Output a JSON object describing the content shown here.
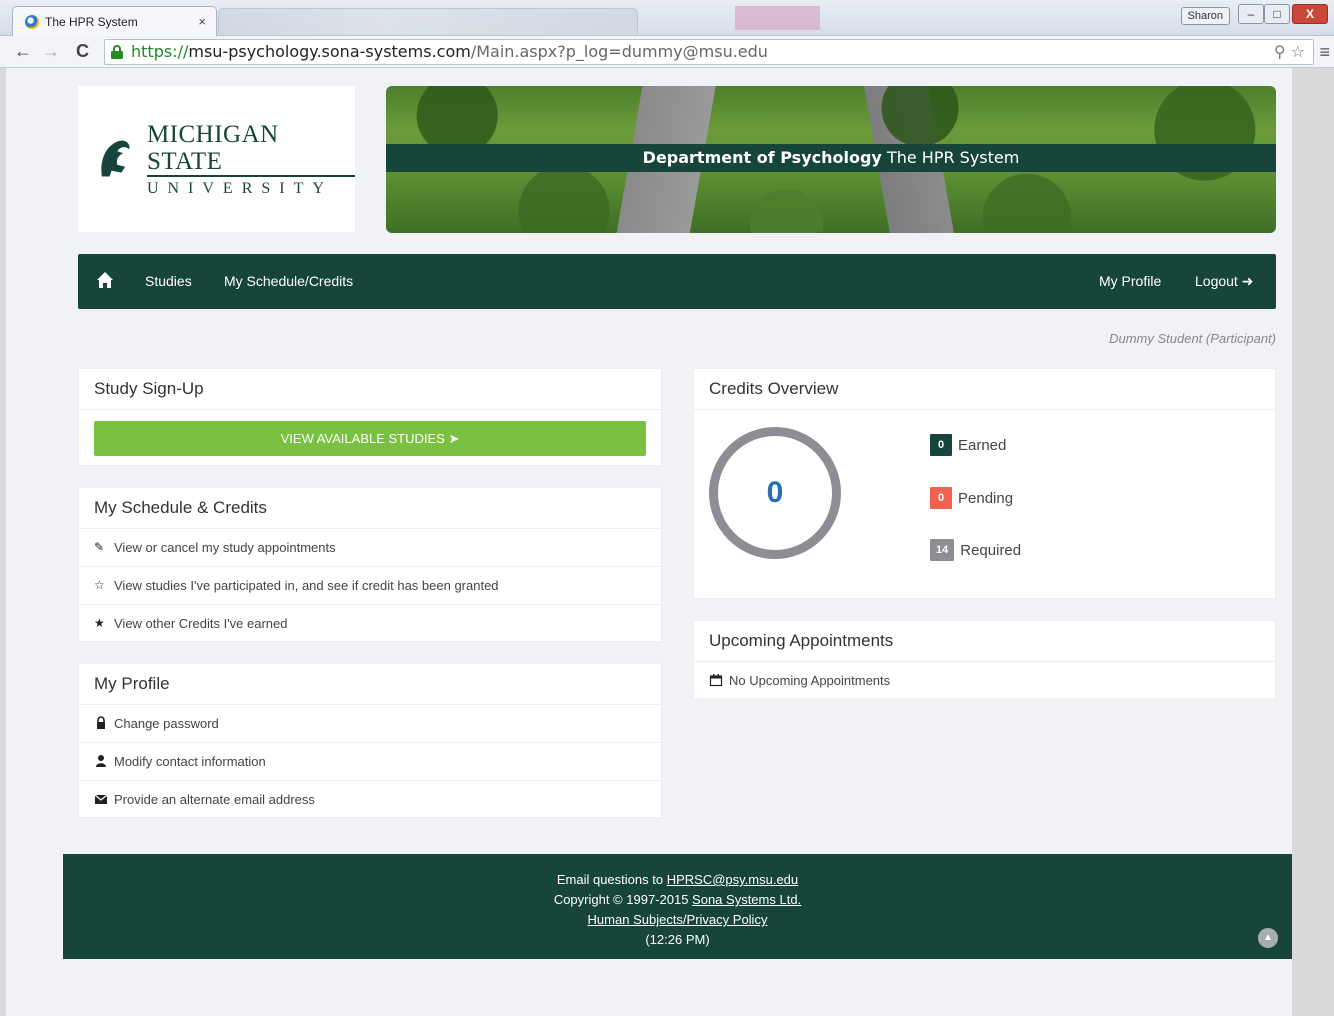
{
  "browser": {
    "tab_title": "The HPR System",
    "tab_close": "×",
    "user_label": "Sharon",
    "win_min": "–",
    "win_max": "□",
    "win_close": "X",
    "url_scheme": "https://",
    "url_host": "msu-psychology.sona-systems.com",
    "url_rest": "/Main.aspx?p_log=dummy@msu.edu",
    "back_icon": "←",
    "forward_icon": "→",
    "reload_icon": "C",
    "key_icon": "⚲",
    "star_icon": "☆",
    "menu_icon": "≡"
  },
  "header": {
    "logo_line1": "MICHIGAN STATE",
    "logo_line2": "UNIVERSITY",
    "banner_bold": "Department of Psychology",
    "banner_rest": "The HPR System"
  },
  "nav": {
    "home_icon": "home-icon",
    "studies": "Studies",
    "schedule": "My Schedule/Credits",
    "profile": "My Profile",
    "logout": "Logout"
  },
  "user": {
    "name_role": "Dummy Student (Participant)"
  },
  "signup": {
    "title": "Study Sign-Up",
    "button": "VIEW AVAILABLE STUDIES"
  },
  "schedule": {
    "title": "My Schedule & Credits",
    "items": [
      {
        "icon": "edit-icon",
        "label": "View or cancel my study appointments"
      },
      {
        "icon": "star-half-icon",
        "label": "View studies I've participated in, and see if credit has been granted"
      },
      {
        "icon": "star-icon",
        "label": "View other Credits I've earned"
      }
    ]
  },
  "profile": {
    "title": "My Profile",
    "items": [
      {
        "icon": "lock-icon",
        "label": "Change password"
      },
      {
        "icon": "user-icon",
        "label": "Modify contact information"
      },
      {
        "icon": "envelope-icon",
        "label": "Provide an alternate email address"
      }
    ]
  },
  "credits": {
    "title": "Credits Overview",
    "total": "0",
    "earned_value": "0",
    "earned_label": "Earned",
    "pending_value": "0",
    "pending_label": "Pending",
    "required_value": "14",
    "required_label": "Required",
    "colors": {
      "earned": "#18453b",
      "pending": "#f0624f",
      "required": "#8d8e93",
      "ring": "#8d8e93"
    }
  },
  "appointments": {
    "title": "Upcoming Appointments",
    "empty": "No Upcoming Appointments"
  },
  "footer": {
    "email_prefix": "Email questions to",
    "email": "HPRSC@psy.msu.edu",
    "copyright_prefix": "Copyright © 1997-2015",
    "company": "Sona Systems Ltd.",
    "policy": "Human Subjects/Privacy Policy",
    "time": "(12:26 PM)"
  },
  "theme": {
    "brand": "#18453b",
    "accent_green": "#7ac143",
    "link_blue": "#2a6db5"
  }
}
